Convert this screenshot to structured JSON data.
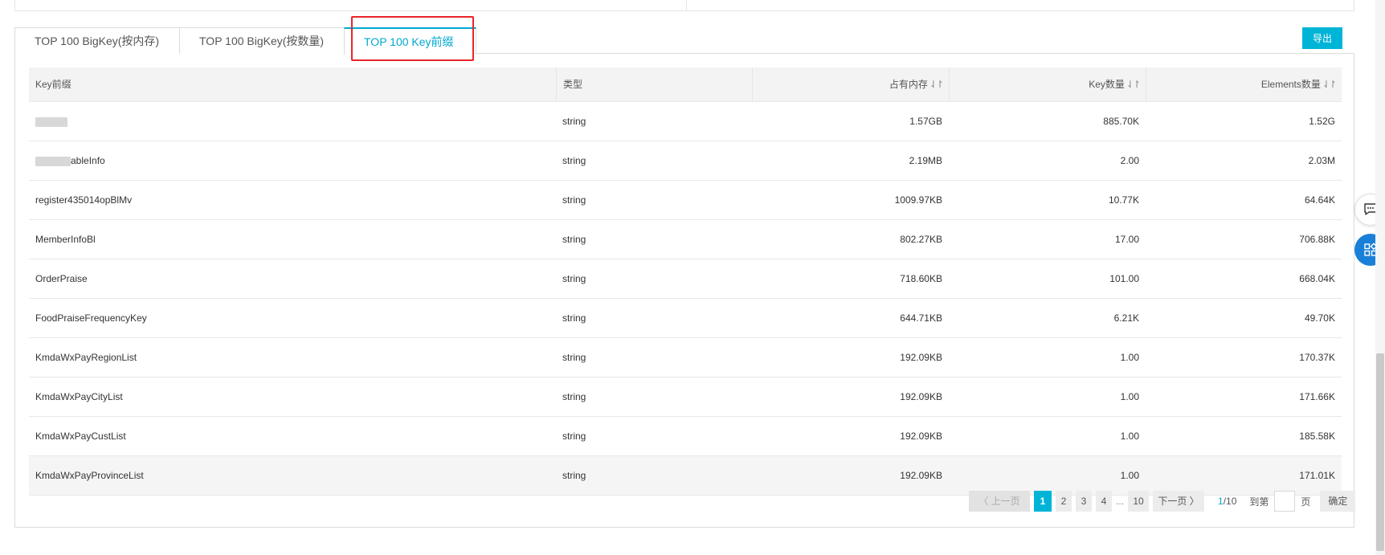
{
  "tabs": [
    {
      "label": "TOP 100 BigKey(按内存)"
    },
    {
      "label": "TOP 100 BigKey(按数量)"
    },
    {
      "label": "TOP 100 Key前缀"
    }
  ],
  "active_tab": 2,
  "toolbar": {
    "export_label": "导出"
  },
  "table": {
    "headers": [
      {
        "label": "Key前缀"
      },
      {
        "label": "类型"
      },
      {
        "label": "占有内存",
        "sort": "⇃↾"
      },
      {
        "label": "Key数量",
        "sort": "⇃↾"
      },
      {
        "label": "Elements数量",
        "sort": "⇃↾"
      }
    ],
    "rows": [
      {
        "key": "",
        "type": "string",
        "memory": "1.57GB",
        "count": "885.70K",
        "elements": "1.52G"
      },
      {
        "key": "ableInfo",
        "type": "string",
        "memory": "2.19MB",
        "count": "2.00",
        "elements": "2.03M"
      },
      {
        "key": "register435014opBlMv",
        "type": "string",
        "memory": "1009.97KB",
        "count": "10.77K",
        "elements": "64.64K"
      },
      {
        "key": "MemberInfoBl",
        "type": "string",
        "memory": "802.27KB",
        "count": "17.00",
        "elements": "706.88K"
      },
      {
        "key": "OrderPraise",
        "type": "string",
        "memory": "718.60KB",
        "count": "101.00",
        "elements": "668.04K"
      },
      {
        "key": "FoodPraiseFrequencyKey",
        "type": "string",
        "memory": "644.71KB",
        "count": "6.21K",
        "elements": "49.70K"
      },
      {
        "key": "KmdaWxPayRegionList",
        "type": "string",
        "memory": "192.09KB",
        "count": "1.00",
        "elements": "170.37K"
      },
      {
        "key": "KmdaWxPayCityList",
        "type": "string",
        "memory": "192.09KB",
        "count": "1.00",
        "elements": "171.66K"
      },
      {
        "key": "KmdaWxPayCustList",
        "type": "string",
        "memory": "192.09KB",
        "count": "1.00",
        "elements": "185.58K"
      },
      {
        "key": "KmdaWxPayProvinceList",
        "type": "string",
        "memory": "192.09KB",
        "count": "1.00",
        "elements": "171.01K"
      }
    ]
  },
  "pagination": {
    "prev_label": "〈 上一页",
    "pages": [
      "1",
      "2",
      "3",
      "4"
    ],
    "ellipsis": "...",
    "last_page": "10",
    "next_label": "下一页 〉",
    "current": "1",
    "total": "/10",
    "goto_label": "到第",
    "page_unit": "页",
    "confirm_label": "确定"
  },
  "colors": {
    "accent": "#00b4d8",
    "highlight": "#e8242b",
    "float_blue": "#1a7fd8"
  },
  "icons": {
    "chat": "chat-bubble-icon",
    "apps": "apps-grid-icon"
  }
}
